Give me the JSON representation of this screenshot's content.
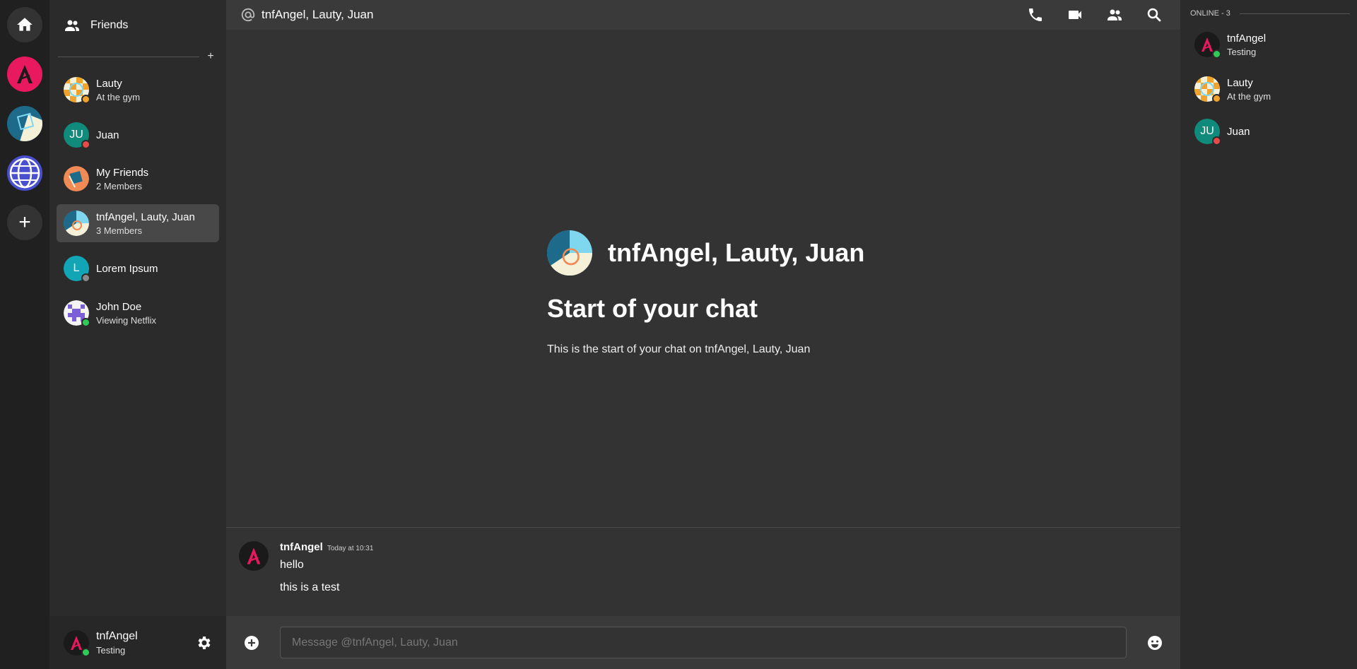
{
  "rail": {
    "icons": [
      "home-icon",
      "server-a-icon",
      "server-square-icon",
      "globe-icon",
      "add-server-icon"
    ],
    "add_label": "+"
  },
  "sidebar": {
    "friends_label": "Friends",
    "add_dm_label": "+",
    "dms": [
      {
        "name": "Lauty",
        "sub": "At the gym",
        "status": "idle"
      },
      {
        "name": "Juan",
        "initials": "JU",
        "sub": "",
        "status": "dnd"
      },
      {
        "name": "My Friends",
        "sub": "2 Members"
      },
      {
        "name": "tnfAngel, Lauty, Juan",
        "sub": "3 Members",
        "active": true
      },
      {
        "name": "Lorem Ipsum",
        "initials": "L",
        "sub": "",
        "status": "offline"
      },
      {
        "name": "John Doe",
        "sub": "Viewing Netflix",
        "status": "online"
      }
    ]
  },
  "user_panel": {
    "name": "tnfAngel",
    "status_text": "Testing",
    "status": "online"
  },
  "header": {
    "title": "tnfAngel, Lauty, Juan",
    "icons": [
      "at-icon",
      "phone-icon",
      "video-icon",
      "members-icon",
      "search-icon"
    ]
  },
  "welcome": {
    "title": "tnfAngel, Lauty, Juan",
    "start": "Start of your chat",
    "desc": "This is the start of your chat on tnfAngel, Lauty, Juan"
  },
  "messages": [
    {
      "author": "tnfAngel",
      "time": "Today at 10:31",
      "lines": [
        "hello",
        "this is a test"
      ]
    }
  ],
  "composer": {
    "placeholder": "Message @tnfAngel, Lauty, Juan"
  },
  "members": {
    "heading": "ONLINE - 3",
    "list": [
      {
        "name": "tnfAngel",
        "sub": "Testing",
        "status": "online"
      },
      {
        "name": "Lauty",
        "sub": "At the gym",
        "status": "idle"
      },
      {
        "name": "Juan",
        "initials": "JU",
        "sub": "",
        "status": "dnd"
      }
    ]
  },
  "colors": {
    "accent_pink": "#e8195f",
    "online": "#2ecc57",
    "idle": "#f0a22b",
    "dnd": "#e84a4a",
    "teal": "#0f8a7b",
    "cyan": "#11a5b5"
  }
}
